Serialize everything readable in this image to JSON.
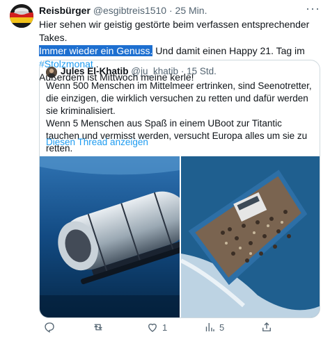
{
  "tweet": {
    "author_name": "Reisbürger",
    "author_handle": "@esgibtreis1510",
    "separator": "·",
    "time": "25 Min.",
    "more_label": "···",
    "text_line1": "Hier sehen wir geistig gestörte beim verfassen entsprechender Takes.",
    "text_highlight": "Immer wieder ein Genuss.",
    "text_line2_rest": " Und damit einen Happy 21. Tag im ",
    "hashtag": "#Stolzmonat",
    "text_line2_end": " .",
    "text_line3": "Außerdem ist Mittwoch meine kerle!"
  },
  "quoted": {
    "author_name": "Jules El-Khatib",
    "author_handle": "@ju_khatib",
    "separator": "·",
    "time": "15 Std.",
    "text_p1": "Wenn 500 Menschen im Mittelmeer ertrinken, sind Seenotretter, die einzigen, die wirklich versuchen zu retten und dafür werden sie kriminalisiert.",
    "text_p2": "Wenn 5 Menschen aus Spaß in einem UBoot zur Titantic tauchen und vermisst werden, versucht Europa alles um sie zu retten.",
    "thread_link": "Diesen Thread anzeigen"
  },
  "actions": {
    "reply_count": "",
    "retweet_count": "",
    "like_count": "1",
    "views_count": "5"
  },
  "colors": {
    "accent": "#1d9bf0",
    "highlight": "#1d6fd0",
    "muted": "#536471",
    "border": "#cfd9de"
  }
}
